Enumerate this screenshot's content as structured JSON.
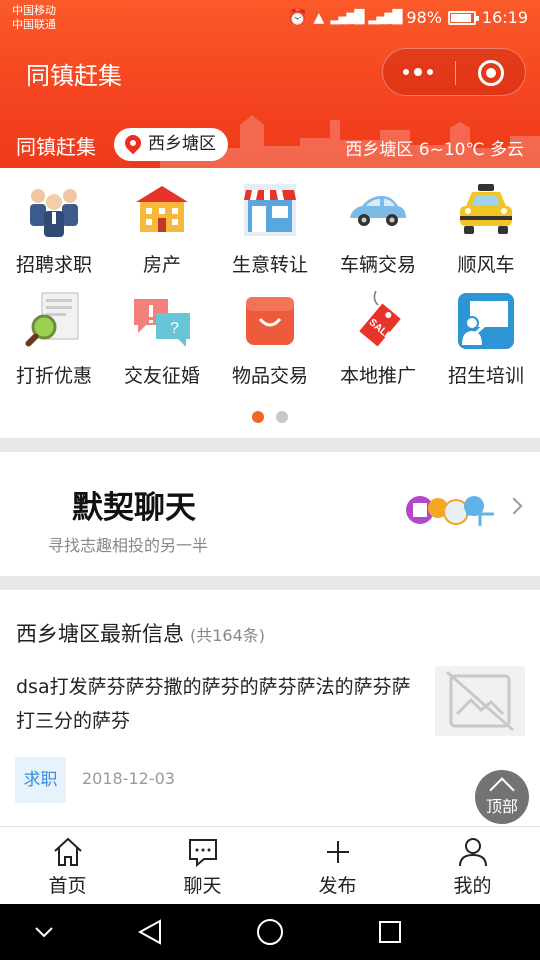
{
  "status_bar": {
    "carrier_1": "中国移动",
    "carrier_2": "中国联通",
    "battery": "98%",
    "time": "16:19"
  },
  "header": {
    "app_title": "同镇赶集",
    "sub_title": "同镇赶集",
    "location": "西乡塘区",
    "weather": "西乡塘区 6~10℃ 多云"
  },
  "categories": [
    {
      "label": "招聘求职",
      "icon": "people-icon"
    },
    {
      "label": "房产",
      "icon": "building-icon"
    },
    {
      "label": "生意转让",
      "icon": "shop-icon"
    },
    {
      "label": "车辆交易",
      "icon": "car-icon"
    },
    {
      "label": "顺风车",
      "icon": "taxi-icon"
    },
    {
      "label": "打折优惠",
      "icon": "magnifier-icon"
    },
    {
      "label": "交友征婚",
      "icon": "chat-bubbles-icon"
    },
    {
      "label": "物品交易",
      "icon": "bag-icon"
    },
    {
      "label": "本地推广",
      "icon": "sale-tag-icon"
    },
    {
      "label": "招生培训",
      "icon": "teacher-icon"
    }
  ],
  "chat_banner": {
    "title": "默契聊天",
    "subtitle": "寻找志趣相投的另一半"
  },
  "info": {
    "heading": "西乡塘区最新信息",
    "count": "(共164条)",
    "post_text": "dsa打发萨芬萨芬撒的萨芬的萨芬萨法的萨芬萨打三分的萨芬",
    "tag": "求职",
    "date": "2018-12-03",
    "top_button": "顶部"
  },
  "tabs": [
    {
      "label": "首页",
      "icon": "home-icon"
    },
    {
      "label": "聊天",
      "icon": "chat-icon"
    },
    {
      "label": "发布",
      "icon": "plus-icon"
    },
    {
      "label": "我的",
      "icon": "user-icon"
    }
  ],
  "colors": {
    "brand_red": "#f4431f",
    "indicator_active": "#f26522",
    "tag_blue": "#3b8fdb"
  }
}
